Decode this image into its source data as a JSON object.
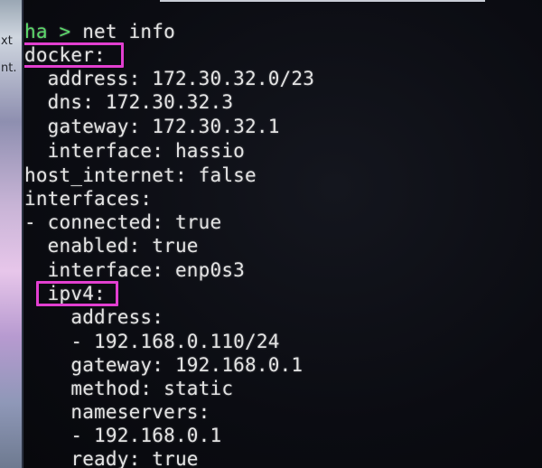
{
  "bezel": {
    "text1": "xt",
    "text2": "nt."
  },
  "terminal": {
    "prompt_host": "ha",
    "prompt_arrow": ">",
    "command": "net info",
    "lines": [
      "docker:",
      "  address: 172.30.32.0/23",
      "  dns: 172.30.32.3",
      "  gateway: 172.30.32.1",
      "  interface: hassio",
      "host_internet: false",
      "interfaces:",
      "- connected: true",
      "  enabled: true",
      "  interface: enp0s3",
      "  ipv4:",
      "    address:",
      "    - 192.168.0.110/24",
      "    gateway: 192.168.0.1",
      "    method: static",
      "    nameservers:",
      "    - 192.168.0.1",
      "    ready: true"
    ]
  },
  "colors": {
    "highlight": "#e23fd0",
    "prompt": "#5bd96a",
    "text": "#e3e3e3",
    "background": "#0a0b10"
  }
}
